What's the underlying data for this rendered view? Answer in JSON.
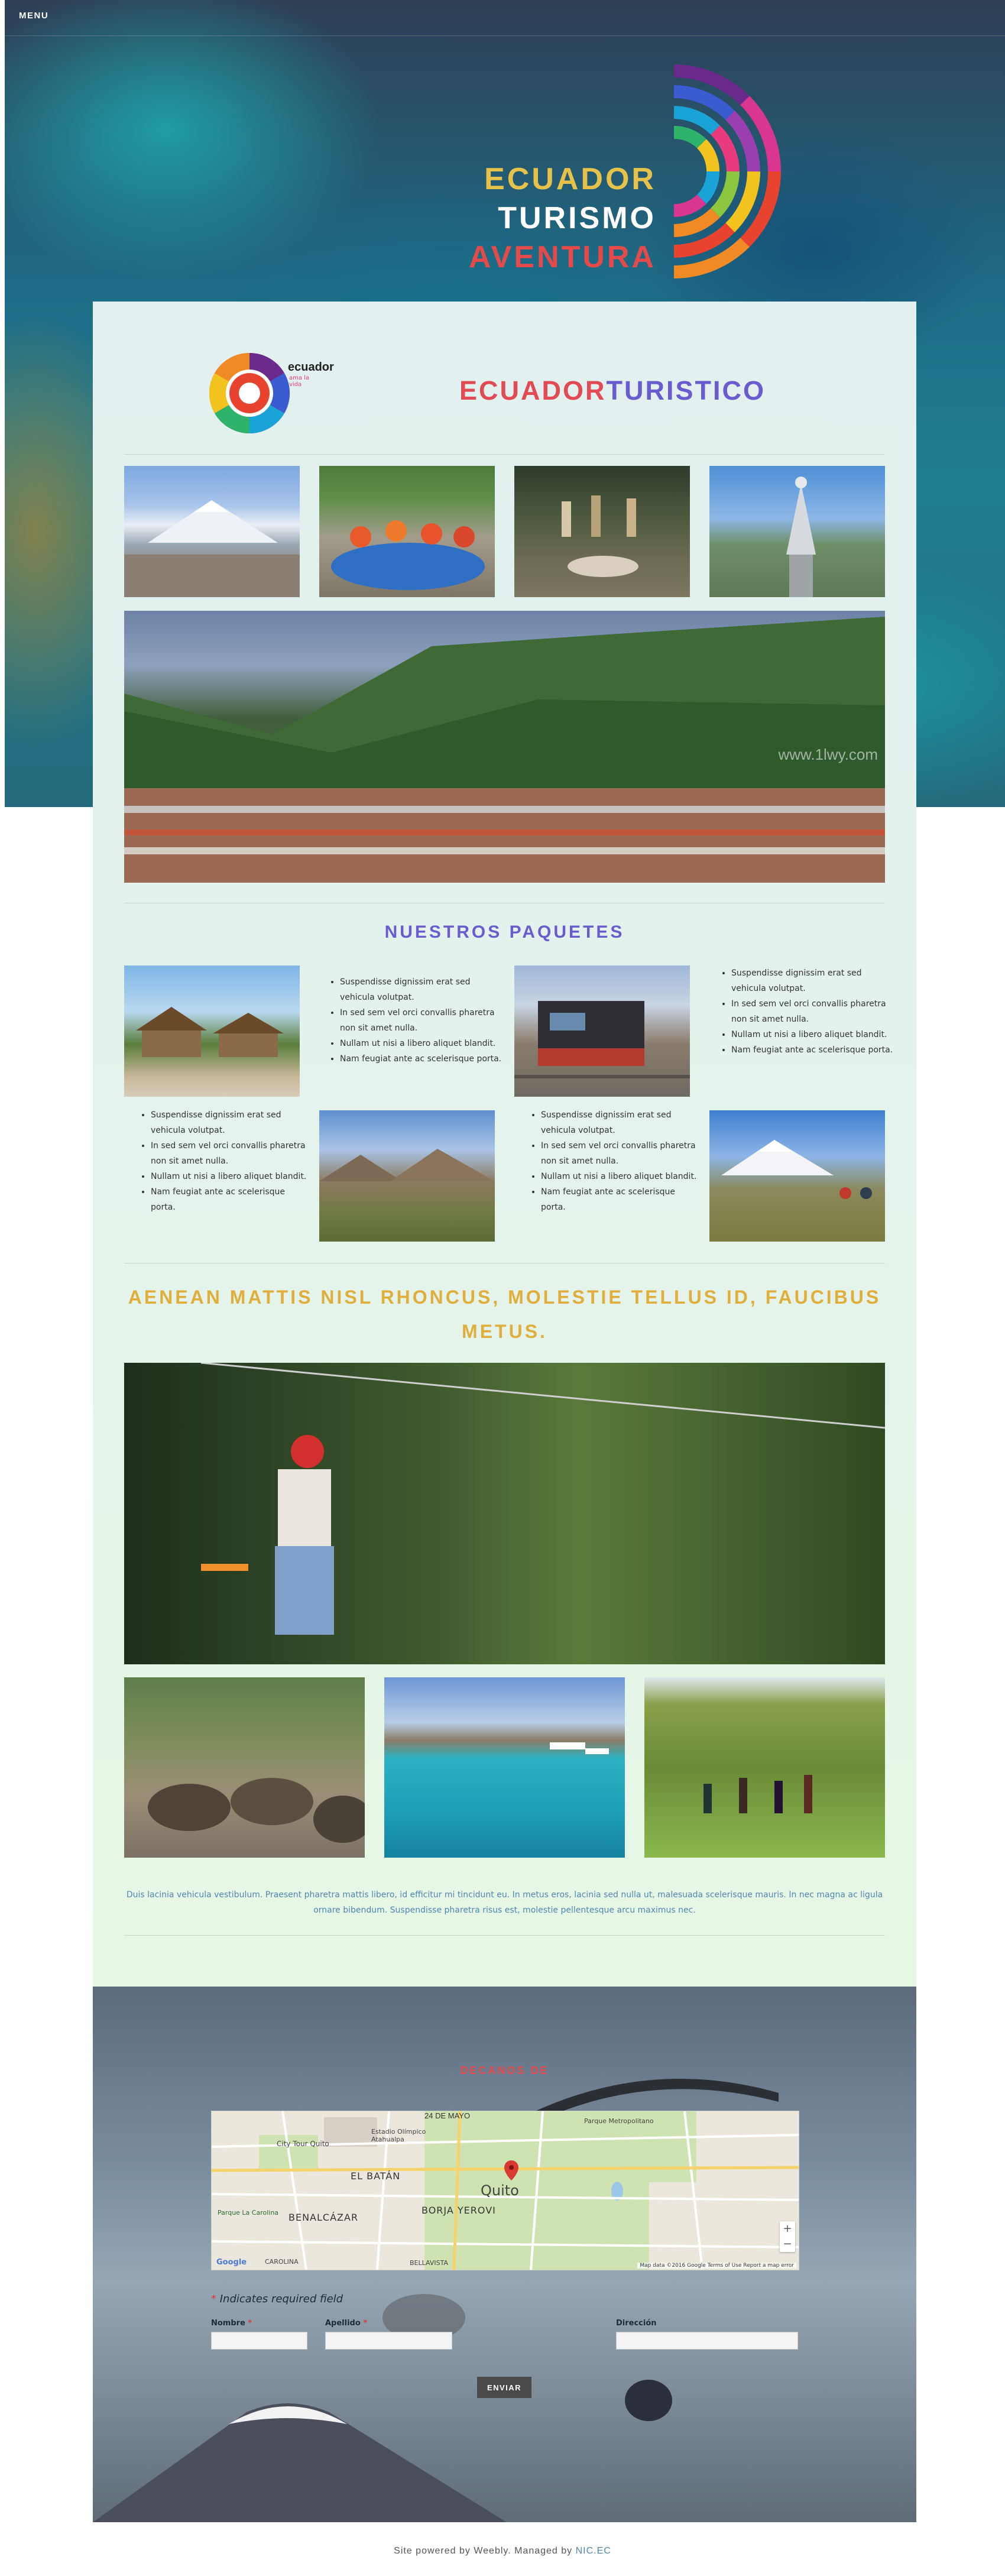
{
  "nav": {
    "menu_label": "MENU"
  },
  "hero": {
    "line1": "ECUADOR",
    "line2": "TURISMO",
    "line3": "AVENTURA"
  },
  "brand": {
    "logo_text": "ecuador",
    "logo_sub": "ama la vida",
    "title_part1": "ECUADOR",
    "title_part2": "TURISTICO"
  },
  "watermark": "www.1lwy.com",
  "packages": {
    "title": "NUESTROS PAQUETES",
    "lists": [
      [
        "Suspendisse dignissim erat sed vehicula volutpat.",
        "In sed sem vel orci convallis pharetra non sit amet nulla.",
        "Nullam ut nisi a libero aliquet blandit.",
        "Nam feugiat ante ac scelerisque porta."
      ],
      [
        "Suspendisse dignissim erat sed vehicula volutpat.",
        "In sed sem vel orci convallis pharetra non sit amet nulla.",
        "Nullam ut nisi a libero aliquet blandit.",
        "Nam feugiat ante ac scelerisque porta."
      ],
      [
        "Suspendisse dignissim erat sed vehicula volutpat.",
        "In sed sem vel orci convallis pharetra non sit amet nulla.",
        "Nullam ut nisi a libero aliquet blandit.",
        "Nam feugiat ante ac scelerisque porta."
      ],
      [
        "Suspendisse dignissim erat sed vehicula volutpat.",
        "In sed sem vel orci convallis pharetra non sit amet nulla.",
        "Nullam ut nisi a libero aliquet blandit.",
        "Nam feugiat ante ac scelerisque porta."
      ]
    ]
  },
  "section2": {
    "title": "AENEAN MATTIS NISL RHONCUS, MOLESTIE TELLUS ID, FAUCIBUS METUS."
  },
  "caption": "Duis lacinia vehicula vestibulum. Praesent pharetra mattis libero, id efficitur mi tincidunt eu. In metus eros, lacinia sed nulla ut, malesuada scelerisque mauris. In nec magna ac ligula ornare bibendum. Suspendisse pharetra risus est, molestie pellentesque arcu maximus nec.",
  "contact": {
    "title": "DECANOS DE",
    "map": {
      "labels": [
        "24 DE MAYO",
        "Estadio Olímpico Atahualpa",
        "City Tour Quito",
        "Parque Metropolitano",
        "EL BATÁN",
        "Quito",
        "Parque La Carolina",
        "BENALCÁZAR",
        "BORJA YEROVI",
        "CAROLINA",
        "BELLAVISTA"
      ],
      "attribution": "Map data ©2016 Google   Terms of Use   Report a map error",
      "google": "Google",
      "zoom_in": "+",
      "zoom_out": "−"
    },
    "required_note": "Indicates required field",
    "star": "*",
    "fields": {
      "name_label": "Nombre",
      "last_label": "Apellido",
      "address_label": "Dirección"
    },
    "submit": "ENVIAR"
  },
  "footer": {
    "prefix": "Site powered by Weebly. Managed by ",
    "link": "NIC.EC"
  },
  "colors": {
    "accent_yellow": "#e7c24a",
    "accent_red": "#e34b54",
    "accent_purple": "#6a5bcf",
    "link_blue": "#4f86b2"
  }
}
